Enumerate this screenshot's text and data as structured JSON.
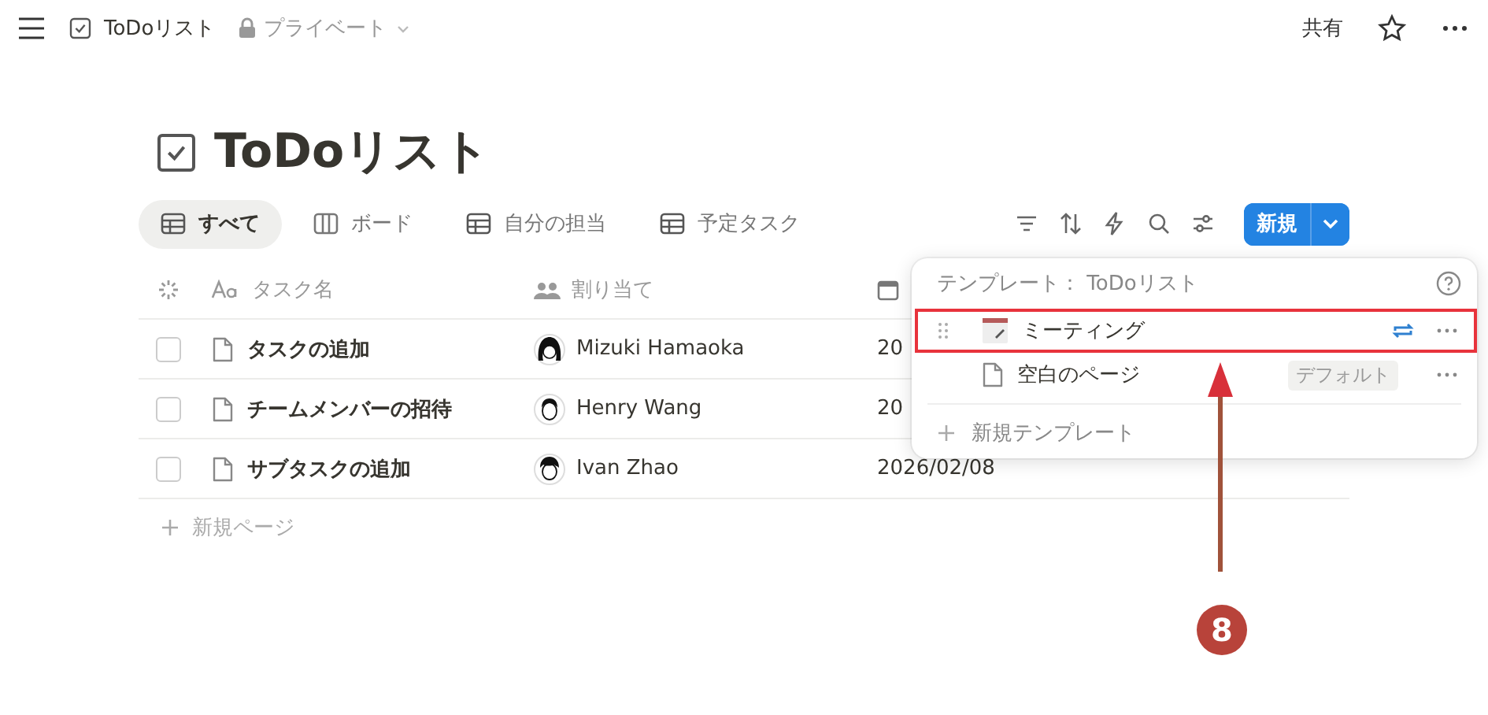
{
  "topbar": {
    "page_title": "ToDoリスト",
    "privacy": "プライベート",
    "share": "共有"
  },
  "title": "ToDoリスト",
  "views": [
    {
      "label": "すべて",
      "kind": "table",
      "selected": true
    },
    {
      "label": "ボード",
      "kind": "board",
      "selected": false
    },
    {
      "label": "自分の担当",
      "kind": "table",
      "selected": false
    },
    {
      "label": "予定タスク",
      "kind": "table",
      "selected": false
    }
  ],
  "new_button": "新規",
  "table": {
    "columns": [
      {
        "label": "タスク名",
        "kind": "title"
      },
      {
        "label": "割り当て",
        "kind": "person"
      },
      {
        "kind": "date"
      }
    ],
    "rows": [
      {
        "checked": false,
        "name": "タスクの追加",
        "assignee": "Mizuki Hamaoka",
        "date": "20"
      },
      {
        "checked": false,
        "name": "チームメンバーの招待",
        "assignee": "Henry Wang",
        "date": "20"
      },
      {
        "checked": false,
        "name": "サブタスクの追加",
        "assignee": "Ivan Zhao",
        "date": "2026/02/08"
      }
    ],
    "new_page": "新規ページ"
  },
  "template_menu": {
    "title": "テンプレート： ToDoリスト",
    "items": [
      {
        "label": "ミーティング",
        "kind": "calendar",
        "highlighted": true,
        "repeat": true
      },
      {
        "label": "空白のページ",
        "kind": "page",
        "highlighted": false,
        "repeat": false,
        "badge": "デフォルト"
      }
    ],
    "new_template": "新規テンプレート"
  },
  "annotation": {
    "number": "8"
  }
}
